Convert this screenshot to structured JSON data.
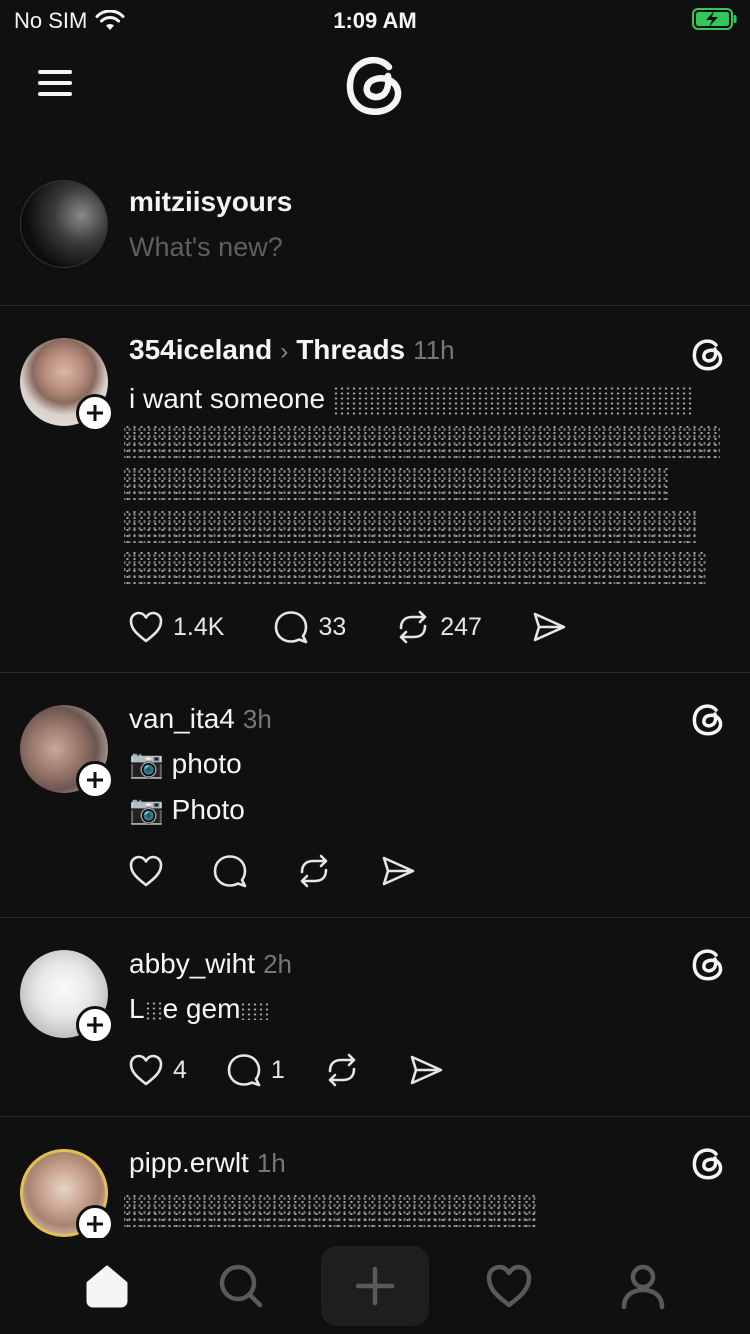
{
  "status_bar": {
    "carrier": "No SIM",
    "time": "1:09 AM"
  },
  "composer": {
    "username": "mitziisyours",
    "placeholder": "What's new?"
  },
  "posts": [
    {
      "username": "354iceland",
      "topic": "Threads",
      "time": "11h",
      "text": "i want someone",
      "likes": "1.4K",
      "replies": "33",
      "reposts": "247"
    },
    {
      "username": "van_ita4",
      "time": "3h",
      "lines": [
        "📷 photo",
        "📷 Photo"
      ],
      "likes": "",
      "replies": "",
      "reposts": ""
    },
    {
      "username": "abby_wiht",
      "time": "2h",
      "text_start": "L",
      "text_mid": "e gem",
      "likes": "4",
      "replies": "1",
      "reposts": ""
    },
    {
      "username": "pipp.erwlt",
      "time": "1h"
    }
  ],
  "tabs": [
    "home-icon",
    "search-icon",
    "create-icon",
    "activity-heart-icon",
    "profile-icon"
  ],
  "colors": {
    "background": "#101010",
    "text": "#f3f5f7",
    "muted": "#777777",
    "battery": "#34c759"
  }
}
